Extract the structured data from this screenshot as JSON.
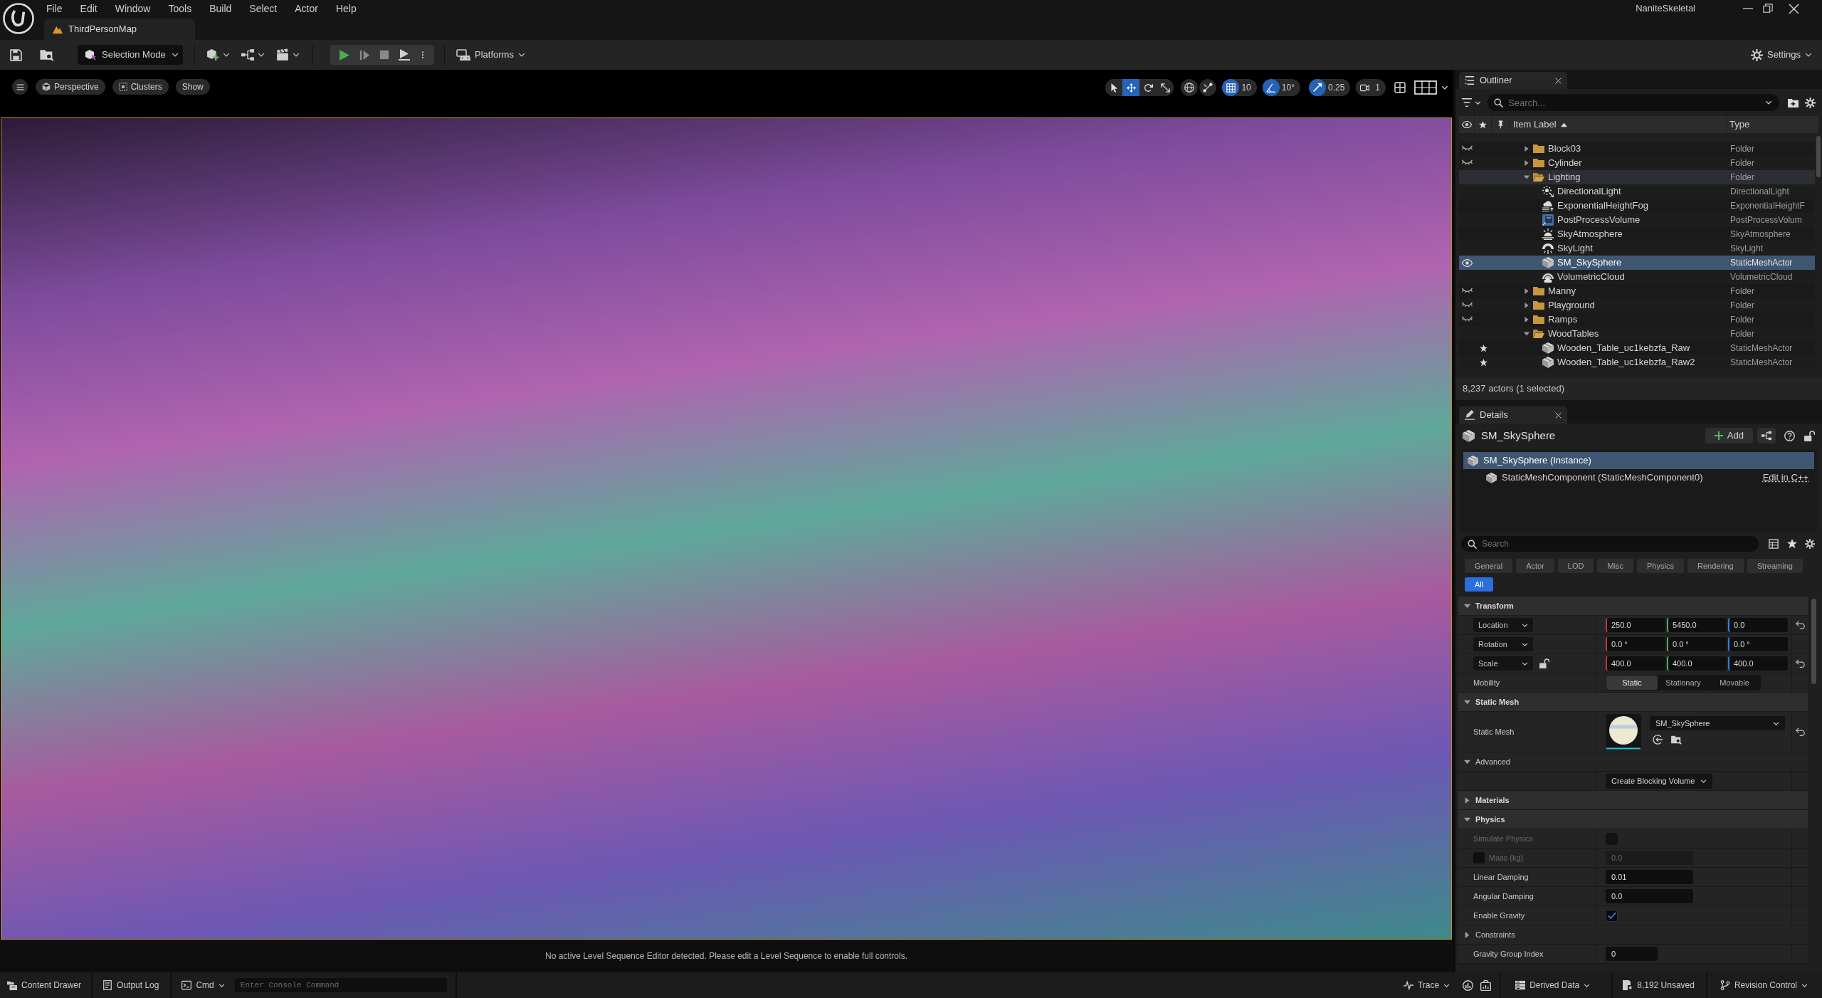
{
  "menu_bar": {
    "items": [
      "File",
      "Edit",
      "Window",
      "Tools",
      "Build",
      "Select",
      "Actor",
      "Help"
    ],
    "project": "NaniteSkeletal"
  },
  "level_tab": {
    "label": "ThirdPersonMap"
  },
  "toolbar": {
    "mode": "Selection Mode",
    "platforms": "Platforms",
    "settings": "Settings"
  },
  "viewport": {
    "view_buttons": [
      {
        "label": "Perspective",
        "kind": "perspective"
      },
      {
        "label": "Clusters",
        "kind": "clusters"
      },
      {
        "label": "Show",
        "kind": "show"
      }
    ],
    "tools": [
      {
        "kind": "select",
        "selected": false
      },
      {
        "kind": "move",
        "selected": true
      },
      {
        "kind": "rotate",
        "selected": false
      },
      {
        "kind": "scale",
        "selected": false
      }
    ],
    "snaps": [
      {
        "kind": "grid",
        "value": "10",
        "on": true
      },
      {
        "kind": "angle",
        "value": "10°",
        "on": true
      },
      {
        "kind": "scale",
        "value": "0.25",
        "on": true
      },
      {
        "kind": "camera",
        "value": "1",
        "on": false
      }
    ],
    "message": "No active Level Sequence Editor detected. Please edit a Level Sequence to enable full controls."
  },
  "outliner": {
    "title": "Outliner",
    "search_placeholder": "Search...",
    "columns": [
      {
        "label": "Item Label",
        "sorted": true
      },
      {
        "label": "Type",
        "sorted": false
      }
    ],
    "rows": [
      {
        "label": "Block03",
        "type": "Folder",
        "kind": "folder",
        "hidden": true,
        "starred": false,
        "selected": false,
        "highlighted": false,
        "expanded": false
      },
      {
        "label": "Cylinder",
        "type": "Folder",
        "kind": "folder",
        "hidden": true,
        "starred": false,
        "selected": false,
        "highlighted": false,
        "expanded": false
      },
      {
        "label": "Lighting",
        "type": "Folder",
        "kind": "folder",
        "hidden": false,
        "starred": false,
        "selected": false,
        "highlighted": true,
        "expanded": true,
        "children": [
          {
            "label": "DirectionalLight",
            "type": "DirectionalLight",
            "kind": "directional_light",
            "hidden": false,
            "starred": false,
            "selected": false,
            "highlighted": false
          },
          {
            "label": "ExponentialHeightFog",
            "type": "ExponentialHeightF",
            "kind": "fog",
            "hidden": false,
            "starred": false,
            "selected": false,
            "highlighted": false
          },
          {
            "label": "PostProcessVolume",
            "type": "PostProcessVolum",
            "kind": "volume",
            "hidden": false,
            "starred": false,
            "selected": false,
            "highlighted": false
          },
          {
            "label": "SkyAtmosphere",
            "type": "SkyAtmosphere",
            "kind": "atmosphere",
            "hidden": false,
            "starred": false,
            "selected": false,
            "highlighted": false
          },
          {
            "label": "SkyLight",
            "type": "SkyLight",
            "kind": "sky_light",
            "hidden": false,
            "starred": false,
            "selected": false,
            "highlighted": false
          },
          {
            "label": "SM_SkySphere",
            "type": "StaticMeshActor",
            "kind": "mesh",
            "hidden": false,
            "starred": false,
            "selected": true,
            "highlighted": false
          },
          {
            "label": "VolumetricCloud",
            "type": "VolumetricCloud",
            "kind": "cloud",
            "hidden": false,
            "starred": false,
            "selected": false,
            "highlighted": false
          }
        ]
      },
      {
        "label": "Manny",
        "type": "Folder",
        "kind": "folder",
        "hidden": true,
        "starred": false,
        "selected": false,
        "highlighted": false,
        "expanded": false
      },
      {
        "label": "Playground",
        "type": "Folder",
        "kind": "folder",
        "hidden": true,
        "starred": false,
        "selected": false,
        "highlighted": false,
        "expanded": false
      },
      {
        "label": "Ramps",
        "type": "Folder",
        "kind": "folder",
        "hidden": true,
        "starred": false,
        "selected": false,
        "highlighted": false,
        "expanded": false
      },
      {
        "label": "WoodTables",
        "type": "Folder",
        "kind": "folder",
        "hidden": false,
        "starred": false,
        "selected": false,
        "highlighted": false,
        "expanded": true,
        "children": [
          {
            "label": "Wooden_Table_uc1kebzfa_Raw",
            "type": "StaticMeshActor",
            "kind": "mesh",
            "hidden": false,
            "starred": true,
            "selected": false,
            "highlighted": false
          },
          {
            "label": "Wooden_Table_uc1kebzfa_Raw2",
            "type": "StaticMeshActor",
            "kind": "mesh",
            "hidden": false,
            "starred": true,
            "selected": false,
            "highlighted": false
          }
        ]
      }
    ],
    "footer": "8,237 actors (1 selected)"
  },
  "details": {
    "title": "Details",
    "actor": "SM_SkySphere",
    "add_button": "Add",
    "components": [
      {
        "label": "SM_SkySphere (Instance)",
        "selected": true,
        "children": [
          {
            "label": "StaticMeshComponent (StaticMeshComponent0)",
            "selected": false,
            "link": "Edit in C++"
          }
        ]
      }
    ],
    "search_placeholder": "Search",
    "filters": [
      {
        "label": "General",
        "selected": false
      },
      {
        "label": "Actor",
        "selected": false
      },
      {
        "label": "LOD",
        "selected": false
      },
      {
        "label": "Misc",
        "selected": false
      },
      {
        "label": "Physics",
        "selected": false
      },
      {
        "label": "Rendering",
        "selected": false
      },
      {
        "label": "Streaming",
        "selected": false
      },
      {
        "label": "All",
        "selected": true
      }
    ],
    "sections": [
      {
        "label": "Transform",
        "expanded": true,
        "rows": [
          {
            "kind": "vector",
            "label": "Location",
            "values": [
              "250.0",
              "5450.0",
              "0.0"
            ],
            "reset": true
          },
          {
            "kind": "vector",
            "label": "Rotation",
            "values": [
              "0.0 °",
              "0.0 °",
              "0.0 °"
            ],
            "reset": false
          },
          {
            "kind": "vector",
            "label": "Scale",
            "values": [
              "400.0",
              "400.0",
              "400.0"
            ],
            "reset": true,
            "ratio_locked": false
          },
          {
            "kind": "choice",
            "label": "Mobility",
            "options": [
              {
                "label": "Static",
                "selected": true
              },
              {
                "label": "Stationary",
                "selected": false
              },
              {
                "label": "Movable",
                "selected": false
              }
            ]
          }
        ]
      },
      {
        "label": "Static Mesh",
        "expanded": true,
        "rows": [
          {
            "kind": "asset",
            "label": "Static Mesh",
            "value": "SM_SkySphere",
            "reset": true
          },
          {
            "kind": "group",
            "label": "Advanced",
            "expanded": true,
            "rows": [
              {
                "kind": "button",
                "label": "Create Blocking Volume"
              }
            ]
          }
        ]
      },
      {
        "label": "Materials",
        "expanded": false
      },
      {
        "label": "Physics",
        "expanded": true,
        "rows": [
          {
            "kind": "checkbox",
            "label": "Simulate Physics",
            "checked": false,
            "disabled": true
          },
          {
            "kind": "number",
            "label": "Mass (kg)",
            "value": "0.0",
            "disabled": true,
            "override": false
          },
          {
            "kind": "number",
            "label": "Linear Damping",
            "value": "0.01",
            "disabled": false
          },
          {
            "kind": "number",
            "label": "Angular Damping",
            "value": "0.0",
            "disabled": false
          },
          {
            "kind": "checkbox",
            "label": "Enable Gravity",
            "checked": true,
            "disabled": false
          },
          {
            "kind": "group",
            "label": "Constraints",
            "expanded": false
          },
          {
            "kind": "integer",
            "label": "Gravity Group Index",
            "value": "0",
            "disabled": false
          }
        ]
      }
    ]
  },
  "status_bar": {
    "content_drawer": "Content Drawer",
    "output_log": "Output Log",
    "cmd": "Cmd",
    "console_placeholder": "Enter Console Command",
    "trace": "Trace",
    "derived_data": "Derived Data",
    "unsaved": "8,192 Unsaved",
    "revision_control": "Revision Control"
  }
}
